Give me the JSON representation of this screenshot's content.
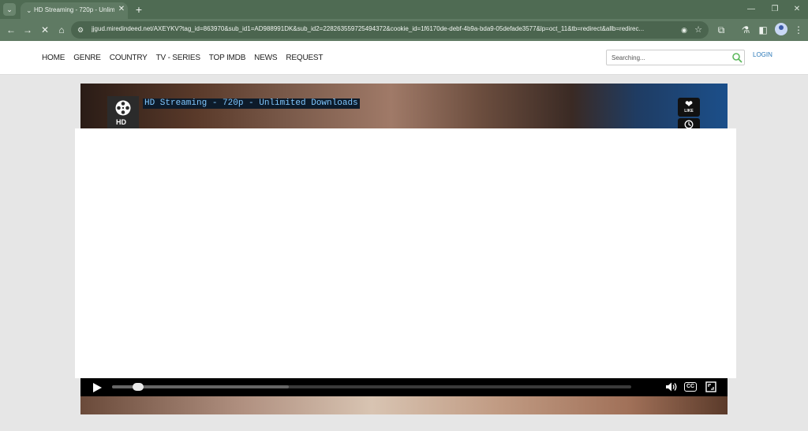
{
  "browser": {
    "tab_title": "HD Streaming - 720p - Unlimi...",
    "tab_close": "✕",
    "new_tab": "+",
    "url": "jjgud.miredindeed.net/AXEYKV?tag_id=863970&sub_id1=AD988991DK&sub_id2=228263559725494372&cookie_id=1f6170de-debf-4b9a-bda9-05defade3577&lp=oct_11&tb=redirect&allb=redirec...",
    "icons": {
      "back": "←",
      "forward": "→",
      "stop": "✕",
      "home": "⌂",
      "site_info": "⚙",
      "tracking": "◉",
      "bookmark": "☆",
      "extensions": "⧉",
      "labs": "⚗",
      "sidepanel": "◧",
      "menu": "⋮",
      "minimize": "—",
      "restore": "❐",
      "close": "✕",
      "tab_search": "⌄",
      "tab_favicon": "⌄"
    }
  },
  "site": {
    "nav": [
      "HOME",
      "GENRE",
      "COUNTRY",
      "TV - SERIES",
      "TOP IMDb",
      "NEWS",
      "REQUEST"
    ],
    "search_placeholder": "Searching...",
    "login": "LOGIN"
  },
  "player": {
    "title": "HD Streaming - 720p - Unlimited Downloads",
    "logo_text": "HD",
    "like_label": "LIKE",
    "like_icon": "❤",
    "cc_label": "CC",
    "progress": 0.04,
    "buffered": 0.34
  }
}
